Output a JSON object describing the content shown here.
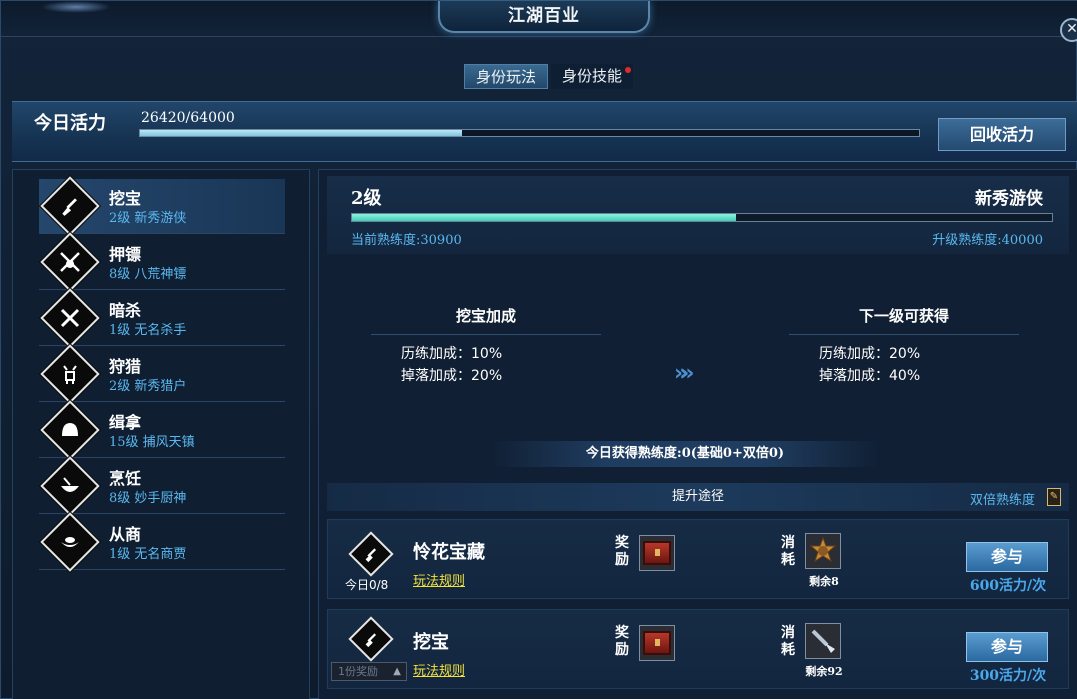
{
  "window": {
    "title": "江湖百业",
    "close_glyph": "✕"
  },
  "tabs": [
    {
      "label": "身份玩法",
      "active": true
    },
    {
      "label": "身份技能",
      "active": false,
      "has_notification": true
    }
  ],
  "vitality": {
    "label": "今日活力",
    "value_text": "26420/64000",
    "fraction": 0.413,
    "recycle_label": "回收活力"
  },
  "jobs": [
    {
      "name": "挖宝",
      "rank": "2级 新秀游侠",
      "icon": "shovel-icon",
      "selected": true
    },
    {
      "name": "押镖",
      "rank": "8级 八荒神镖",
      "icon": "crossed-swords-icon",
      "selected": false
    },
    {
      "name": "暗杀",
      "rank": "1级 无名杀手",
      "icon": "crossed-daggers-icon",
      "selected": false
    },
    {
      "name": "狩猎",
      "rank": "2级 新秀猎户",
      "icon": "deer-icon",
      "selected": false
    },
    {
      "name": "缉拿",
      "rank": "15级 捕风天镇",
      "icon": "helmet-icon",
      "selected": false
    },
    {
      "name": "烹饪",
      "rank": "8级 妙手厨神",
      "icon": "cooking-bowl-icon",
      "selected": false
    },
    {
      "name": "从商",
      "rank": "1级 无名商贾",
      "icon": "ingot-icon",
      "selected": false
    }
  ],
  "detail": {
    "level": "2级",
    "title": "新秀游侠",
    "progress_fraction": 0.5486,
    "current_proficiency": "当前熟练度:30900",
    "upgrade_proficiency": "升级熟练度:40000",
    "bonus_current": {
      "title": "挖宝加成",
      "lines": [
        "历练加成：10%",
        "掉落加成：20%"
      ]
    },
    "bonus_next": {
      "title": "下一级可获得",
      "lines": [
        "历练加成：20%",
        "掉落加成：40%"
      ]
    },
    "arrow": "»»",
    "today_gain": "今日获得熟练度:0(基础0+双倍0)",
    "ways_title": "提升途径",
    "double_label": "双倍熟练度",
    "double_icon_glyph": "✎"
  },
  "activities": [
    {
      "name": "怜花宝藏",
      "rules_label": "玩法规则",
      "count": "今日0/8",
      "reward_tag": "奖励",
      "cost_tag": "消耗",
      "reward_icon": "treasure-chest-icon",
      "cost_icon": "gold-medal-icon",
      "remain": "剩余8",
      "join_label": "参与",
      "cost_text": "600活力/次"
    },
    {
      "name": "挖宝",
      "rules_label": "玩法规则",
      "reward_select": "1份奖励",
      "reward_tag": "奖励",
      "cost_tag": "消耗",
      "reward_icon": "treasure-chest-icon",
      "cost_icon": "shovel-tool-icon",
      "remain": "剩余92",
      "join_label": "参与",
      "cost_text": "300活力/次"
    }
  ]
}
